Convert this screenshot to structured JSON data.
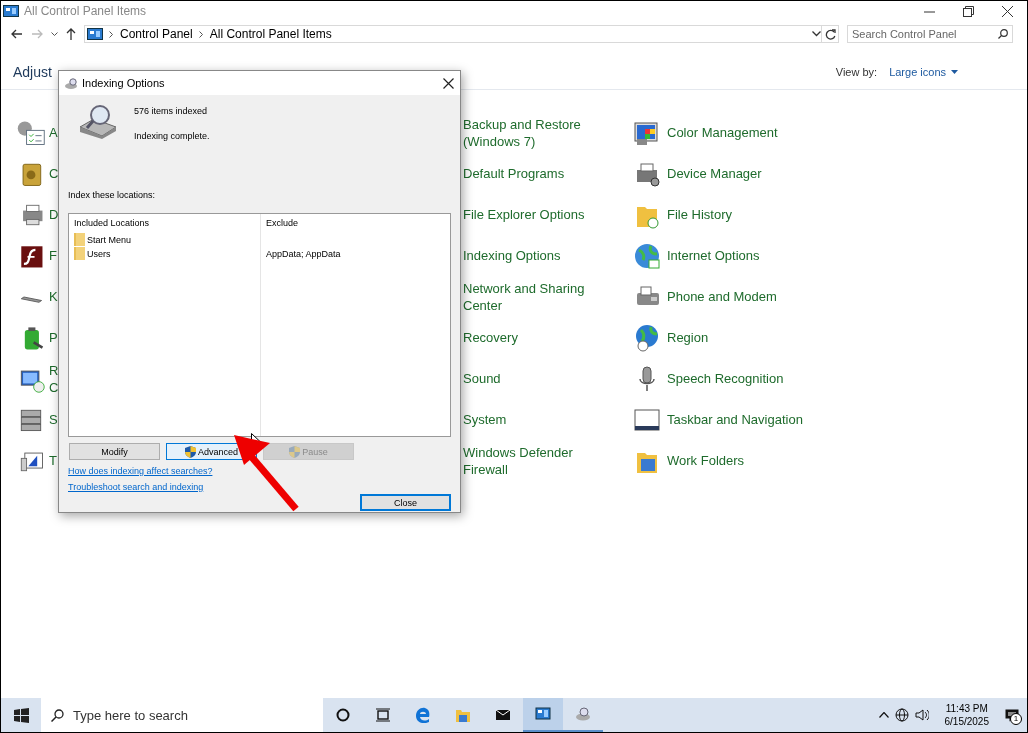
{
  "window": {
    "title": "All Control Panel Items",
    "breadcrumb": [
      "Control Panel",
      "All Control Panel Items"
    ],
    "search": {
      "placeholder": "Search Control Panel"
    }
  },
  "header": {
    "title": "Adjust",
    "view_by_label": "View by:",
    "view_by_value": "Large icons"
  },
  "columns": [
    {
      "items": [
        {
          "label": "A"
        },
        {
          "label": "C"
        },
        {
          "label": "D"
        },
        {
          "label": "F"
        },
        {
          "label": "K"
        },
        {
          "label": "P"
        },
        {
          "label": "R",
          "second_line": "C"
        },
        {
          "label": "S"
        },
        {
          "label": "T"
        }
      ]
    },
    {
      "items": [
        {
          "label": "Backup and Restore (Windows 7)"
        },
        {
          "label": "Default Programs"
        },
        {
          "label": "File Explorer Options"
        },
        {
          "label": "Indexing Options"
        },
        {
          "label": "Network and Sharing Center"
        },
        {
          "label": "Recovery"
        },
        {
          "label": "Sound"
        },
        {
          "label": "System"
        },
        {
          "label": "Windows Defender Firewall"
        }
      ]
    },
    {
      "items": [
        {
          "label": "Color Management"
        },
        {
          "label": "Device Manager"
        },
        {
          "label": "File History"
        },
        {
          "label": "Internet Options"
        },
        {
          "label": "Phone and Modem"
        },
        {
          "label": "Region"
        },
        {
          "label": "Speech Recognition"
        },
        {
          "label": "Taskbar and Navigation"
        },
        {
          "label": "Work Folders"
        }
      ]
    }
  ],
  "dialog": {
    "title": "Indexing Options",
    "count": "576 items indexed",
    "status": "Indexing complete.",
    "locations_label": "Index these locations:",
    "table": {
      "columns": [
        "Included Locations",
        "Exclude"
      ],
      "rows": [
        {
          "location": "Start Menu"
        },
        {
          "location": "Users",
          "exclude": "AppData; AppData"
        }
      ]
    },
    "buttons": [
      {
        "label": "Modify",
        "shield": false,
        "disabled": false,
        "hovered": false
      },
      {
        "label": "Advanced",
        "shield": true,
        "disabled": false,
        "hovered": true
      },
      {
        "label": "Pause",
        "shield": true,
        "disabled": true,
        "hovered": false
      }
    ],
    "links": [
      "How does indexing affect searches?",
      "Troubleshoot search and indexing"
    ],
    "close_button": {
      "label": "Close",
      "default": true
    }
  },
  "taskbar": {
    "search": {
      "placeholder": "Type here to search"
    },
    "apps": [
      {
        "kind": "cortana",
        "running": false,
        "selected": false
      },
      {
        "kind": "taskview",
        "running": false,
        "selected": false
      },
      {
        "kind": "edge",
        "running": false,
        "selected": false
      },
      {
        "kind": "explorer",
        "running": false,
        "selected": false
      },
      {
        "kind": "mail",
        "running": false,
        "selected": false
      },
      {
        "kind": "control-panel",
        "running": true,
        "selected": true
      },
      {
        "kind": "indexing",
        "running": true,
        "selected": false
      }
    ],
    "time": "11:43 PM",
    "date": "6/15/2025",
    "notifications": "1"
  }
}
